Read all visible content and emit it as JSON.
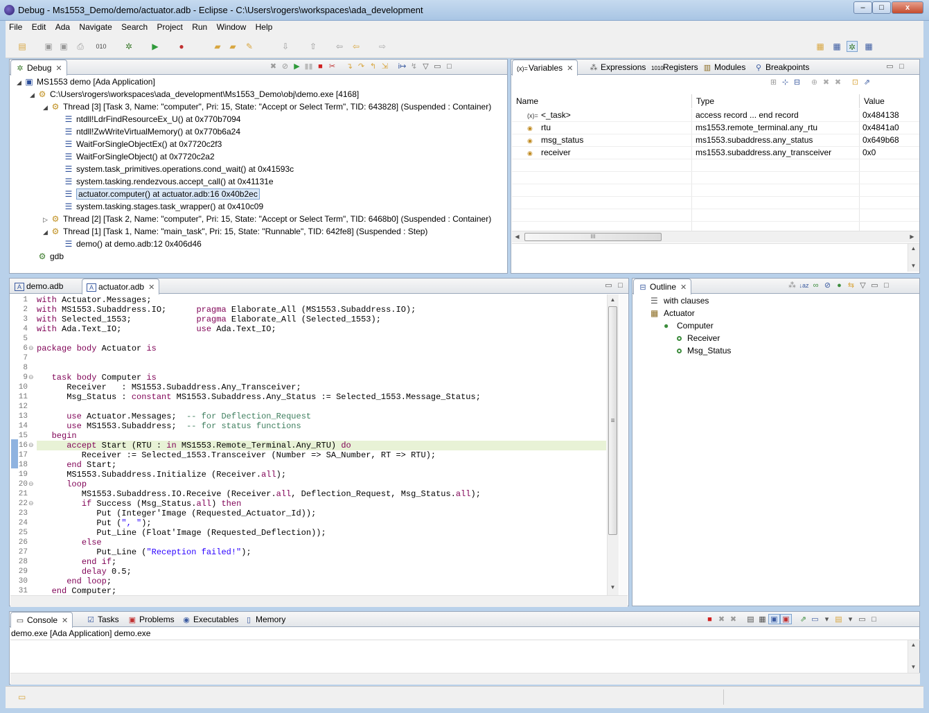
{
  "window": {
    "title": "Debug - Ms1553_Demo/demo/actuator.adb - Eclipse - C:\\Users\\rogers\\workspaces\\ada_development",
    "min_label": "–",
    "max_label": "□",
    "close_label": "x"
  },
  "menu": [
    "File",
    "Edit",
    "Ada",
    "Navigate",
    "Search",
    "Project",
    "Run",
    "Window",
    "Help"
  ],
  "debug_view": {
    "tab_label": "Debug",
    "tree": [
      {
        "label": "MS1553 demo [Ada Application]",
        "level": 0,
        "twisty": "◢",
        "icon": "launch-icon"
      },
      {
        "label": "C:\\Users\\rogers\\workspaces\\ada_development\\Ms1553_Demo\\obj\\demo.exe [4168]",
        "level": 1,
        "twisty": "◢",
        "icon": "process-icon"
      },
      {
        "label": "Thread [3] [Task 3, Name: \"computer\", Pri: 15, State: \"Accept or Select Term\", TID: 643828] (Suspended : Container)",
        "level": 2,
        "twisty": "◢",
        "icon": "thread-icon"
      },
      {
        "label": "ntdll!LdrFindResourceEx_U() at 0x770b7094",
        "level": 3,
        "twisty": "",
        "icon": "stack-frame-icon"
      },
      {
        "label": "ntdll!ZwWriteVirtualMemory() at 0x770b6a24",
        "level": 3,
        "twisty": "",
        "icon": "stack-frame-icon"
      },
      {
        "label": "WaitForSingleObjectEx() at 0x7720c2f3",
        "level": 3,
        "twisty": "",
        "icon": "stack-frame-icon"
      },
      {
        "label": "WaitForSingleObject() at 0x7720c2a2",
        "level": 3,
        "twisty": "",
        "icon": "stack-frame-icon"
      },
      {
        "label": "system.task_primitives.operations.cond_wait() at 0x41593c",
        "level": 3,
        "twisty": "",
        "icon": "stack-frame-icon"
      },
      {
        "label": "system.tasking.rendezvous.accept_call() at 0x41131e",
        "level": 3,
        "twisty": "",
        "icon": "stack-frame-icon"
      },
      {
        "label": "actuator.computer() at actuator.adb:16 0x40b2ec",
        "level": 3,
        "twisty": "",
        "icon": "stack-frame-icon",
        "selected": true
      },
      {
        "label": "system.tasking.stages.task_wrapper() at 0x410c09",
        "level": 3,
        "twisty": "",
        "icon": "stack-frame-icon"
      },
      {
        "label": "Thread [2] [Task 2, Name: \"computer\", Pri: 15, State: \"Accept or Select Term\", TID: 6468b0] (Suspended : Container)",
        "level": 2,
        "twisty": "▷",
        "icon": "thread-icon"
      },
      {
        "label": "Thread [1] [Task 1, Name: \"main_task\", Pri: 15, State: \"Runnable\", TID: 642fe8] (Suspended : Step)",
        "level": 2,
        "twisty": "◢",
        "icon": "thread-icon"
      },
      {
        "label": "demo() at demo.adb:12 0x406d46",
        "level": 3,
        "twisty": "",
        "icon": "stack-frame-icon"
      },
      {
        "label": "gdb",
        "level": 1,
        "twisty": "",
        "icon": "gdb-icon"
      }
    ]
  },
  "variables_view": {
    "tabs": [
      "Variables",
      "Expressions",
      "Registers",
      "Modules",
      "Breakpoints"
    ],
    "columns": [
      "Name",
      "Type",
      "Value"
    ],
    "rows": [
      {
        "name": "<_task>",
        "type": "access record ... end record",
        "value": "0x484138",
        "icon": "(x)="
      },
      {
        "name": "rtu",
        "type": "ms1553.remote_terminal.any_rtu",
        "value": "0x4841a0",
        "icon": "variable-icon"
      },
      {
        "name": "msg_status",
        "type": "ms1553.subaddress.any_status",
        "value": "0x649b68",
        "icon": "variable-icon"
      },
      {
        "name": "receiver",
        "type": "ms1553.subaddress.any_transceiver",
        "value": "0x0",
        "icon": "variable-icon"
      }
    ],
    "hscroll_grip": "III"
  },
  "editor": {
    "tabs": [
      "demo.adb",
      "actuator.adb"
    ],
    "active_tab": "actuator.adb",
    "line_numbers": [
      "1",
      "2",
      "3",
      "4",
      "5",
      "6",
      "7",
      "8",
      "9",
      "10",
      "11",
      "12",
      "13",
      "14",
      "15",
      "16",
      "17",
      "18",
      "19",
      "20",
      "21",
      "22",
      "23",
      "24",
      "25",
      "26",
      "27",
      "28",
      "29",
      "30",
      "31"
    ],
    "lines": [
      "<span class=kw>with</span> Actuator.Messages;",
      "<span class=kw>with</span> MS1553.Subaddress.IO;      <span class=kw>pragma</span> Elaborate_All (MS1553.Subaddress.IO);",
      "<span class=kw>with</span> Selected_1553;             <span class=kw>pragma</span> Elaborate_All (Selected_1553);",
      "<span class=kw>with</span> Ada.Text_IO;               <span class=kw>use</span> Ada.Text_IO;",
      "",
      "<span class=kw>package body</span> Actuator <span class=kw>is</span>",
      "",
      "",
      "   <span class=kw>task body</span> Computer <span class=kw>is</span>",
      "      Receiver   : MS1553.Subaddress.Any_Transceiver;",
      "      Msg_Status : <span class=kw>constant</span> MS1553.Subaddress.Any_Status := Selected_1553.Message_Status;",
      "",
      "      <span class=kw>use</span> Actuator.Messages;  <span class=cm>-- for Deflection_Request</span>",
      "      <span class=kw>use</span> MS1553.Subaddress;  <span class=cm>-- for status functions</span>",
      "   <span class=kw>begin</span>",
      "      <span class=kw>accept</span> Start (RTU : <span class=kw>in</span> MS1553.Remote_Terminal.Any_RTU) <span class=kw>do</span>",
      "         Receiver := Selected_1553.Transceiver (Number => SA_Number, RT => RTU);",
      "      <span class=kw>end</span> Start;",
      "      MS1553.Subaddress.Initialize (Receiver.<span class=kw>all</span>);",
      "      <span class=kw>loop</span>",
      "         MS1553.Subaddress.IO.Receive (Receiver.<span class=kw>all</span>, Deflection_Request, Msg_Status.<span class=kw>all</span>);",
      "         <span class=kw>if</span> Success (Msg_Status.<span class=kw>all</span>) <span class=kw>then</span>",
      "            Put (Integer'Image (Requested_Actuator_Id));",
      "            Put (<span class=st>\", \"</span>);",
      "            Put_Line (Float'Image (Requested_Deflection));",
      "         <span class=kw>else</span>",
      "            Put_Line (<span class=st>\"Reception failed!\"</span>);",
      "         <span class=kw>end if</span>;",
      "         <span class=kw>delay</span> 0.5;",
      "      <span class=kw>end loop</span>;",
      "   <span class=kw>end</span> Computer;"
    ],
    "current_line": 16,
    "fold_lines": [
      6,
      9,
      16,
      20,
      22
    ],
    "overview_grip": "≡"
  },
  "outline_view": {
    "tab_label": "Outline",
    "items": [
      {
        "label": "with clauses",
        "level": 0,
        "icon": "with-clauses-icon"
      },
      {
        "label": "Actuator",
        "level": 0,
        "icon": "package-icon"
      },
      {
        "label": "Computer",
        "level": 1,
        "icon": "task-icon"
      },
      {
        "label": "Receiver",
        "level": 2,
        "icon": "object-icon"
      },
      {
        "label": "Msg_Status",
        "level": 2,
        "icon": "object-icon"
      }
    ]
  },
  "console_view": {
    "tabs": [
      "Console",
      "Tasks",
      "Problems",
      "Executables",
      "Memory"
    ],
    "description": "demo.exe [Ada Application] demo.exe"
  }
}
